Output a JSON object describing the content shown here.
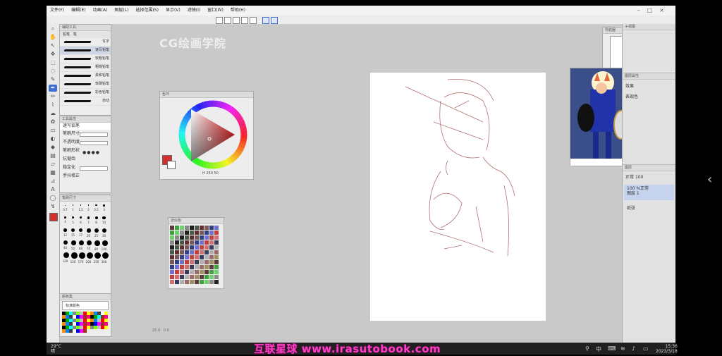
{
  "menu": [
    "文件(F)",
    "编辑(E)",
    "动画(A)",
    "图层(L)",
    "选择范围(S)",
    "显示(V)",
    "滤镜(I)",
    "窗口(W)",
    "帮助(H)"
  ],
  "subtool_panel": {
    "tabs": [
      "铅笔",
      "笔"
    ],
    "brushes": [
      "写字",
      "速写铅笔",
      "较粗铅笔",
      "粗糙铅笔",
      "柔和铅笔",
      "软碳铅笔",
      "彩色铅笔",
      "自动"
    ]
  },
  "tool_property": {
    "brush_name": "速写铅笔",
    "rows": [
      "笔刷尺寸",
      "不透明度",
      "笔刷形状",
      "抗锯齿",
      "稳定化",
      "手抖修正"
    ]
  },
  "brush_sizes": [
    "0.7",
    "1",
    "1.5",
    "2",
    "2.5",
    "3",
    "4",
    "5",
    "6",
    "7",
    "8",
    "10",
    "12",
    "15",
    "17",
    "20",
    "25",
    "30",
    "40",
    "50",
    "60",
    "70",
    "80",
    "100",
    "120",
    "150",
    "170",
    "200",
    "250",
    "300"
  ],
  "workspace_brand": "CG绘画学院",
  "colorwheel": {
    "label_h": "H",
    "value1": "250",
    "value2": "50",
    "main_color": "#d42e2e"
  },
  "color_set": {
    "title": "标准颜色"
  },
  "status": {
    "zoom": "25.0",
    "coords": "0.0"
  },
  "layers": {
    "blend": "正常",
    "opacity": "100",
    "layer1": "100 %正常",
    "layer1_name": "图层 1",
    "paper": "纸张"
  },
  "watermark": "互联星球 www.irasutobook.com",
  "taskbar": {
    "temp": "29°C",
    "weather": "晴",
    "time": "15:36",
    "date": "2023/3/18"
  },
  "colors": {
    "accent": "#3d6fd6",
    "watermark": "#ff3ec8",
    "main_color": "#d42e2e"
  }
}
